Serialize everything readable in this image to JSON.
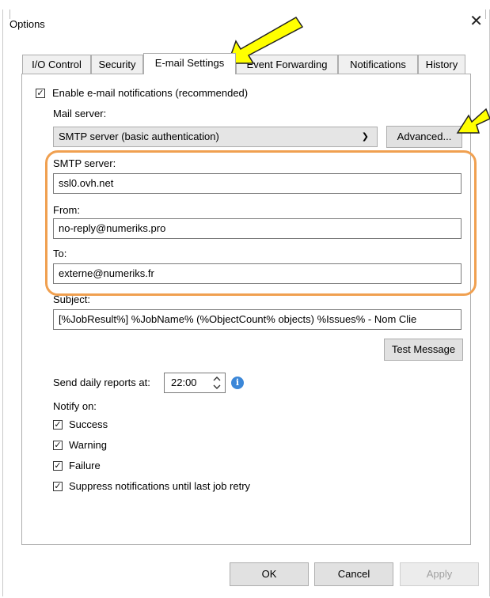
{
  "window": {
    "title": "Options",
    "close_glyph": "✕"
  },
  "tabs": [
    {
      "label": "I/O Control"
    },
    {
      "label": "Security"
    },
    {
      "label": "E-mail Settings",
      "active": true
    },
    {
      "label": "Event Forwarding"
    },
    {
      "label": "Notifications"
    },
    {
      "label": "History"
    }
  ],
  "email": {
    "enable_label": "Enable e-mail notifications (recommended)",
    "enable_checked": true,
    "mail_server_label": "Mail server:",
    "mail_server_value": "SMTP server (basic authentication)",
    "advanced_label": "Advanced...",
    "smtp_label": "SMTP server:",
    "smtp_value": "ssl0.ovh.net",
    "from_label": "From:",
    "from_value": "no-reply@numeriks.pro",
    "to_label": "To:",
    "to_value": "externe@numeriks.fr",
    "subject_label": "Subject:",
    "subject_value": "[%JobResult%] %JobName% (%ObjectCount% objects) %Issues% - Nom Clie",
    "test_message_label": "Test Message",
    "daily_label": "Send daily reports at:",
    "daily_time": "22:00",
    "notify_label": "Notify on:",
    "notify": [
      {
        "label": "Success",
        "checked": true
      },
      {
        "label": "Warning",
        "checked": true
      },
      {
        "label": "Failure",
        "checked": true
      },
      {
        "label": "Suppress notifications until last job retry",
        "checked": true
      }
    ]
  },
  "footer": {
    "ok": "OK",
    "cancel": "Cancel",
    "apply": "Apply"
  },
  "colors": {
    "highlight_box": "#f0a050",
    "arrow_annotation": "#ffff00",
    "info_icon": "#3b87d8"
  }
}
